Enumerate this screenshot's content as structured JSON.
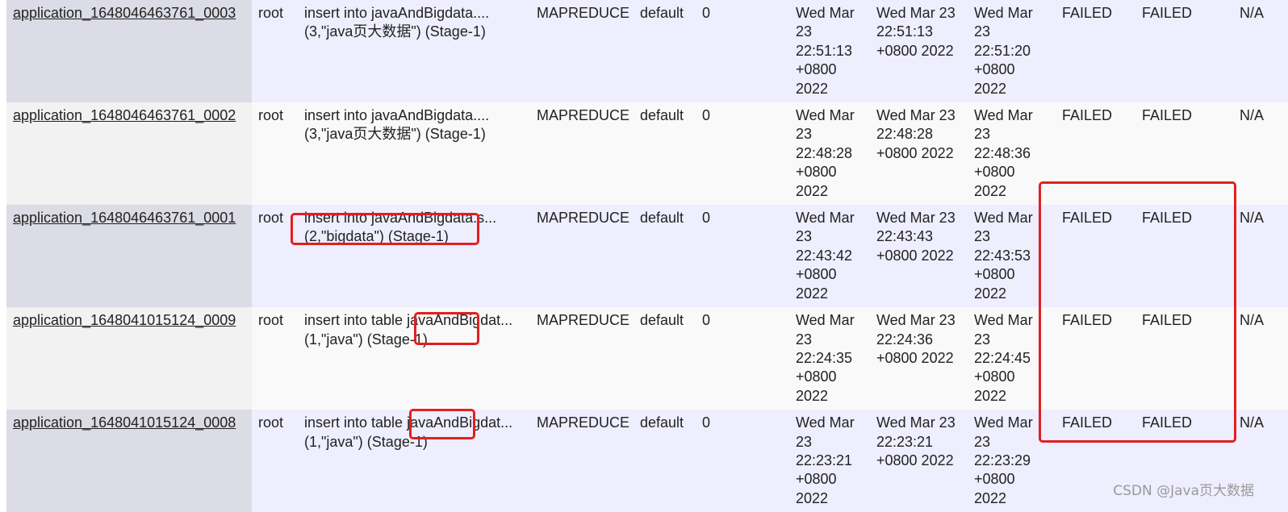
{
  "rows": [
    {
      "id": "application_1648046463761_0003",
      "user": "root",
      "name": "insert into javaAndBigdata.... (3,\"java页大数据\") (Stage-1)",
      "type": "MAPREDUCE",
      "queue": "default",
      "priority": "0",
      "start": "Wed Mar 23 22:51:13 +0800 2022",
      "launch": "Wed Mar 23 22:51:13 +0800 2022",
      "finish": "Wed Mar 23 22:51:20 +0800 2022",
      "state": "FAILED",
      "final": "FAILED",
      "extra": "N/A"
    },
    {
      "id": "application_1648046463761_0002",
      "user": "root",
      "name": "insert into javaAndBigdata.... (3,\"java页大数据\") (Stage-1)",
      "type": "MAPREDUCE",
      "queue": "default",
      "priority": "0",
      "start": "Wed Mar 23 22:48:28 +0800 2022",
      "launch": "Wed Mar 23 22:48:28 +0800 2022",
      "finish": "Wed Mar 23 22:48:36 +0800 2022",
      "state": "FAILED",
      "final": "FAILED",
      "extra": "N/A"
    },
    {
      "id": "application_1648046463761_0001",
      "user": "root",
      "name": "insert into javaAndBigdata.s... (2,\"bigdata\") (Stage-1)",
      "type": "MAPREDUCE",
      "queue": "default",
      "priority": "0",
      "start": "Wed Mar 23 22:43:42 +0800 2022",
      "launch": "Wed Mar 23 22:43:43 +0800 2022",
      "finish": "Wed Mar 23 22:43:53 +0800 2022",
      "state": "FAILED",
      "final": "FAILED",
      "extra": "N/A"
    },
    {
      "id": "application_1648041015124_0009",
      "user": "root",
      "name": "insert into table javaAndBigdat...(1,\"java\") (Stage-1)",
      "type": "MAPREDUCE",
      "queue": "default",
      "priority": "0",
      "start": "Wed Mar 23 22:24:35 +0800 2022",
      "launch": "Wed Mar 23 22:24:36 +0800 2022",
      "finish": "Wed Mar 23 22:24:45 +0800 2022",
      "state": "FAILED",
      "final": "FAILED",
      "extra": "N/A"
    },
    {
      "id": "application_1648041015124_0008",
      "user": "root",
      "name": "insert into table javaAndBigdat...(1,\"java\") (Stage-1)",
      "type": "MAPREDUCE",
      "queue": "default",
      "priority": "0",
      "start": "Wed Mar 23 22:23:21 +0800 2022",
      "launch": "Wed Mar 23 22:23:21 +0800 2022",
      "finish": "Wed Mar 23 22:23:29 +0800 2022",
      "state": "FAILED",
      "final": "FAILED",
      "extra": "N/A"
    }
  ],
  "watermark": "CSDN @Java页大数据",
  "colors": {
    "highlight": "#e02020",
    "row_odd": "#eeeeff",
    "row_even": "#f9f9f9"
  }
}
